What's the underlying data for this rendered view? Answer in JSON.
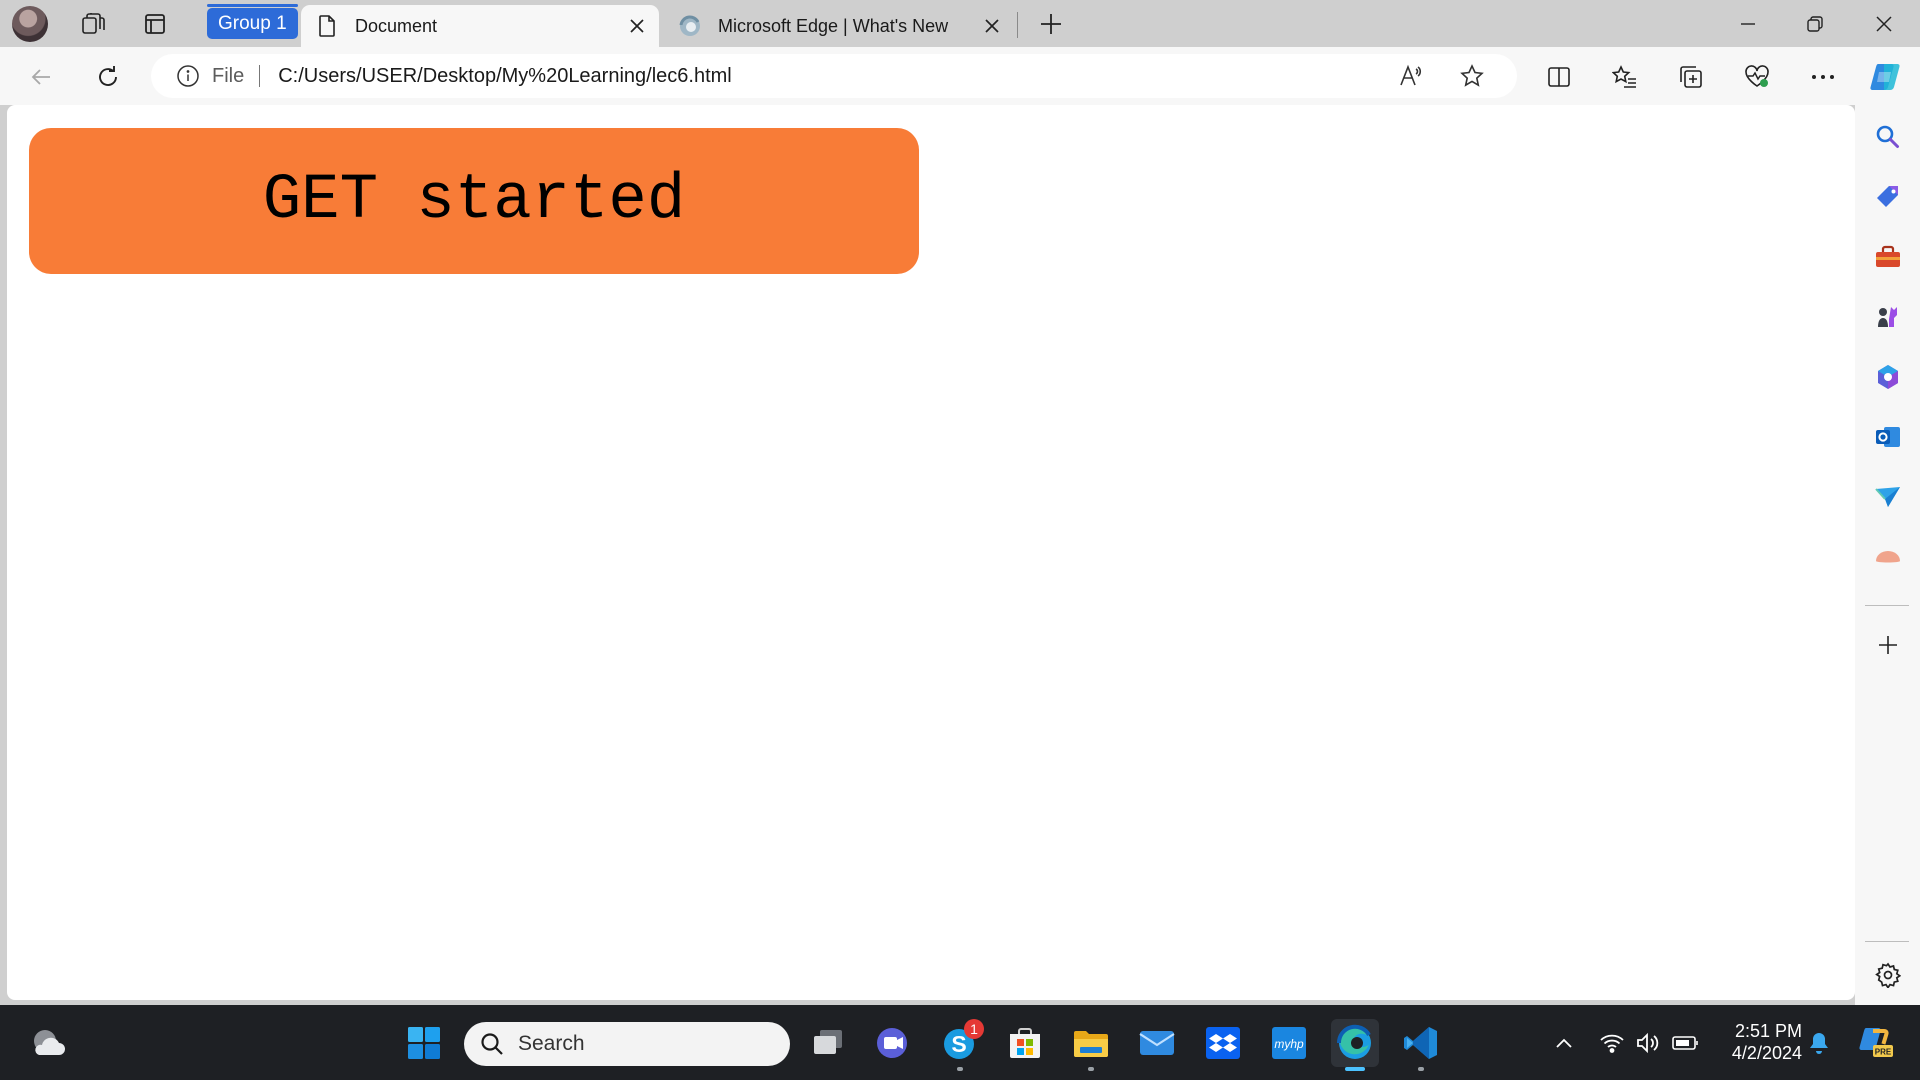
{
  "browser": {
    "tab_group_label": "Group 1",
    "tabs": [
      {
        "title": "Document",
        "active": true,
        "icon": "document-icon"
      },
      {
        "title": "Microsoft Edge | What's New",
        "active": false,
        "icon": "edge-icon"
      }
    ],
    "address_bar": {
      "scheme_label": "File",
      "url": "C:/Users/USER/Desktop/My%20Learning/lec6.html"
    }
  },
  "page": {
    "cta_label": "GET started",
    "cta_color": "#f87c37"
  },
  "taskbar": {
    "search_placeholder": "Search",
    "skype_badge": "1",
    "clock_time": "2:51 PM",
    "clock_date": "4/2/2024"
  },
  "colors": {
    "accent": "#2d6bd8",
    "taskbar_bg": "#1e2024"
  }
}
